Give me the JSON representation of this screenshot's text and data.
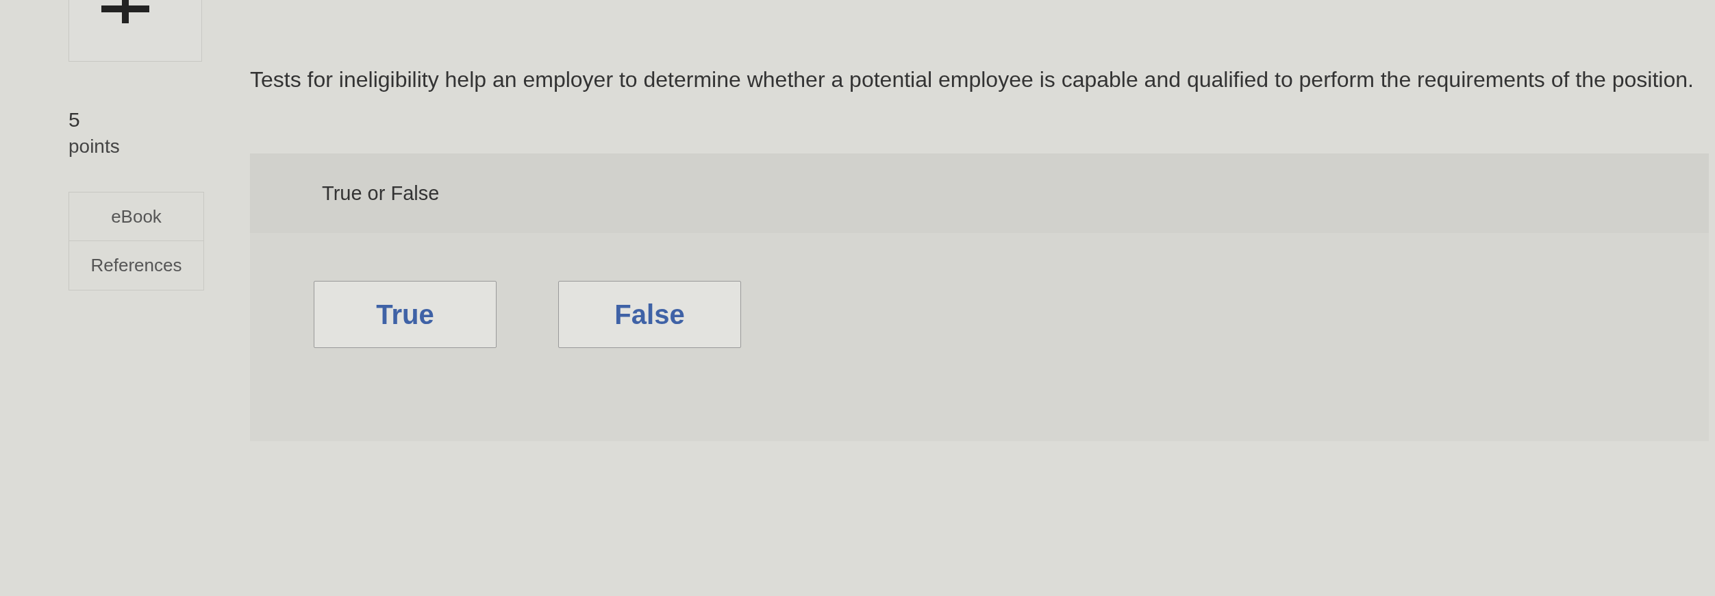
{
  "points": {
    "value": "5",
    "label": "points"
  },
  "question": "Tests for ineligibility help an employer to determine whether a potential employee is capable and qualified to perform the requirements of the position.",
  "side_tabs": [
    {
      "label": "eBook"
    },
    {
      "label": "References"
    }
  ],
  "answer_panel": {
    "title": "True or False",
    "options": [
      {
        "label": "True"
      },
      {
        "label": "False"
      }
    ]
  }
}
